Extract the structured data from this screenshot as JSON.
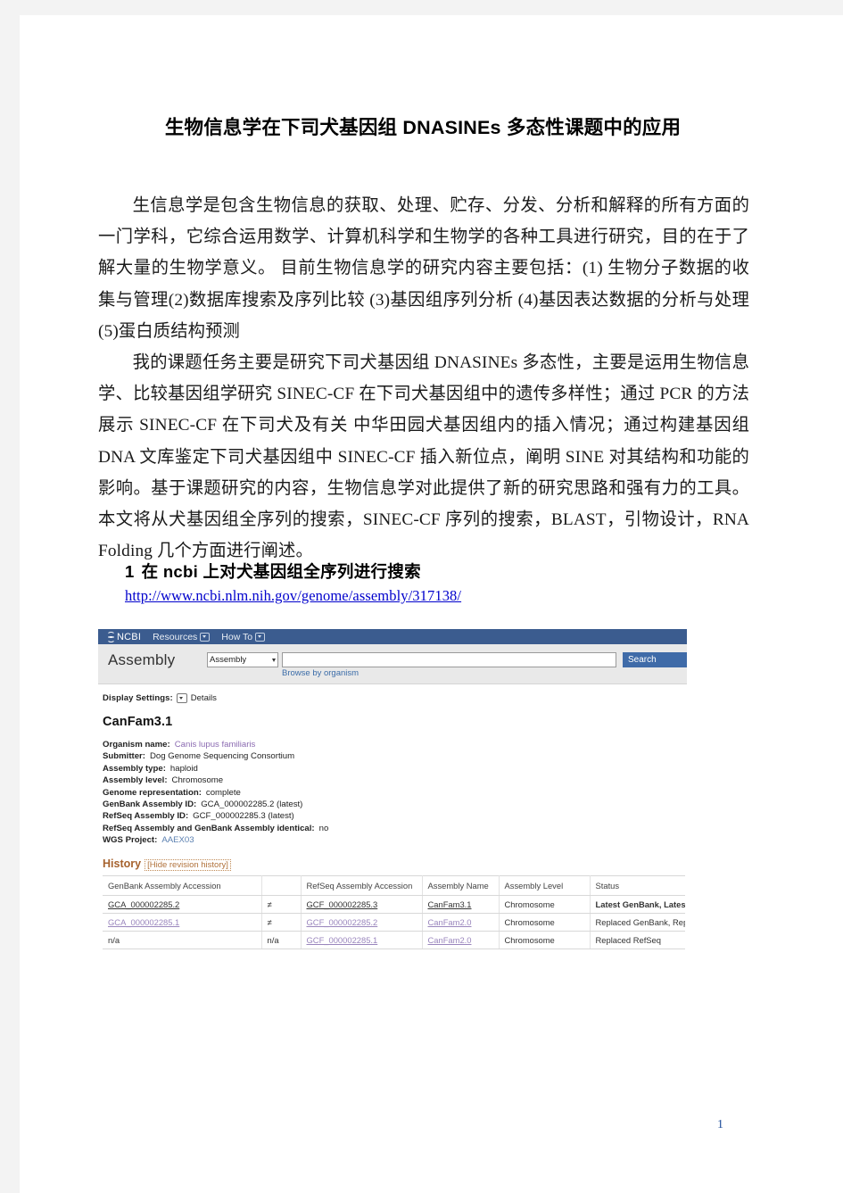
{
  "document": {
    "title": "生物信息学在下司犬基因组 DNASINEs 多态性课题中的应用",
    "paragraph1": "生信息学是包含生物信息的获取、处理、贮存、分发、分析和解释的所有方面的一门学科，它综合运用数学、计算机科学和生物学的各种工具进行研究，目的在于了解大量的生物学意义。 目前生物信息学的研究内容主要包括：(1) 生物分子数据的收集与管理(2)数据库搜索及序列比较 (3)基因组序列分析 (4)基因表达数据的分析与处理 (5)蛋白质结构预测",
    "paragraph2": "我的课题任务主要是研究下司犬基因组 DNASINEs 多态性，主要是运用生物信息学、比较基因组学研究 SINEC-CF 在下司犬基因组中的遗传多样性；通过 PCR 的方法展示 SINEC-CF 在下司犬及有关 中华田园犬基因组内的插入情况；通过构建基因组 DNA 文库鉴定下司犬基因组中 SINEC-CF 插入新位点，阐明 SINE 对其结构和功能的影响。基于课题研究的内容，生物信息学对此提供了新的研究思路和强有力的工具。本文将从犬基因组全序列的搜索，SINEC-CF 序列的搜索，BLAST，引物设计，RNA Folding 几个方面进行阐述。",
    "section": {
      "number": "1",
      "heading": "在 ncbi 上对犬基因组全序列进行搜索",
      "url": "http://www.ncbi.nlm.nih.gov/genome/assembly/317138/"
    },
    "page_number": "1"
  },
  "screenshot": {
    "topbar": {
      "logo": "NCBI",
      "menu_resources": "Resources",
      "menu_howto": "How To"
    },
    "searchbar": {
      "database_title": "Assembly",
      "select_value": "Assembly",
      "input_value": "",
      "search_button": "Search",
      "browse_link": "Browse by organism"
    },
    "display_settings": {
      "label": "Display Settings:",
      "value": "Details"
    },
    "assembly": {
      "name": "CanFam3.1",
      "fields": [
        {
          "key": "Organism name:",
          "value": "Canis lupus familiaris",
          "style": "link"
        },
        {
          "key": "Submitter:",
          "value": "Dog Genome Sequencing Consortium",
          "style": "plain"
        },
        {
          "key": "Assembly type:",
          "value": "haploid",
          "style": "plain"
        },
        {
          "key": "Assembly level:",
          "value": "Chromosome",
          "style": "plain"
        },
        {
          "key": "Genome representation:",
          "value": "complete",
          "style": "plain"
        },
        {
          "key": "GenBank Assembly ID:",
          "value": "GCA_000002285.2 (latest)",
          "style": "plain"
        },
        {
          "key": "RefSeq Assembly ID:",
          "value": "GCF_000002285.3 (latest)",
          "style": "plain"
        },
        {
          "key": "RefSeq Assembly and GenBank Assembly identical:",
          "value": "no",
          "style": "plain"
        },
        {
          "key": "WGS Project:",
          "value": "AAEX03",
          "style": "blue"
        }
      ]
    },
    "history": {
      "title": "History",
      "toggle": "[Hide revision history]",
      "columns": [
        "GenBank Assembly Accession",
        "",
        "RefSeq Assembly Accession",
        "Assembly Name",
        "Assembly Level",
        "Status"
      ],
      "rows": [
        {
          "genbank": "GCA_000002285.2",
          "eq": "≠",
          "refseq": "GCF_000002285.3",
          "name": "CanFam3.1",
          "level": "Chromosome",
          "status": "Latest GenBank, Latest RefSeq",
          "dim": false,
          "bold_status": true
        },
        {
          "genbank": "GCA_000002285.1",
          "eq": "≠",
          "refseq": "GCF_000002285.2",
          "name": "CanFam2.0",
          "level": "Chromosome",
          "status": "Replaced GenBank, Replaced RefSeq",
          "dim": true,
          "bold_status": false
        },
        {
          "genbank": "n/a",
          "eq": "n/a",
          "refseq": "GCF_000002285.1",
          "name": "CanFam2.0",
          "level": "Chromosome",
          "status": "Replaced RefSeq",
          "dim": true,
          "bold_status": false,
          "na": true
        }
      ]
    }
  }
}
